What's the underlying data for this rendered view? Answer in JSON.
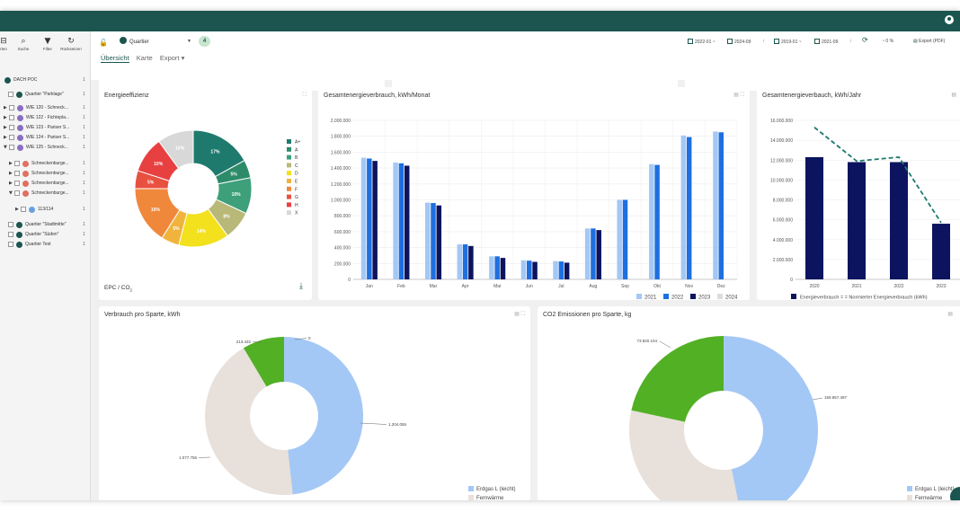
{
  "sidebar": {
    "toolbar": [
      {
        "label": "rten",
        "icon": "filter-funnel-partial-icon"
      },
      {
        "label": "Suche",
        "icon": "search-icon"
      },
      {
        "label": "Filter",
        "icon": "filter-icon"
      },
      {
        "label": "Rücksetzen",
        "icon": "reset-icon"
      }
    ],
    "tree": [
      {
        "label": "DACH POC",
        "count": "1",
        "level": 0,
        "color": "#1c5550"
      },
      {
        "label": "Quartier \"Parklage\"",
        "count": "1",
        "level": 1,
        "color": "#1c5550"
      },
      {
        "label": "WIE 120 - Schneck...",
        "count": "1",
        "level": 2,
        "color": "#8a6fc0"
      },
      {
        "label": "WIE 122 - Fichtepla...",
        "count": "1",
        "level": 2,
        "color": "#8a6fc0"
      },
      {
        "label": "WIE 123 - Pariser S...",
        "count": "1",
        "level": 2,
        "color": "#8a6fc0"
      },
      {
        "label": "WIE 124 - Pariser S...",
        "count": "1",
        "level": 2,
        "color": "#8a6fc0"
      },
      {
        "label": "WIE 125 - Schneck...",
        "count": "1",
        "level": 2,
        "color": "#8a6fc0"
      },
      {
        "label": "Schneckenburge...",
        "count": "1",
        "level": 3,
        "color": "#e07060"
      },
      {
        "label": "Schneckenburge...",
        "count": "1",
        "level": 3,
        "color": "#e07060"
      },
      {
        "label": "Schneckenburge...",
        "count": "1",
        "level": 3,
        "color": "#e07060"
      },
      {
        "label": "Schneckenburge...",
        "count": "1",
        "level": 3,
        "color": "#e07060"
      },
      {
        "label": "113/114",
        "count": "1",
        "level": 4,
        "color": "#6aa0e0"
      },
      {
        "label": "Quartier \"Stadtmitte\"",
        "count": "1",
        "level": 1,
        "color": "#1c5550"
      },
      {
        "label": "Quartier \"Süden\"",
        "count": "1",
        "level": 1,
        "color": "#1c5550"
      },
      {
        "label": "Quartier Test",
        "count": "1",
        "level": 1,
        "color": "#1c5550"
      }
    ]
  },
  "header": {
    "quartier_label": "Quartier",
    "quartier_count": "4",
    "tabs": [
      "Übersicht",
      "Karte",
      "Export ▾"
    ],
    "filters": [
      "2022-01 ~",
      "2024-09",
      "2019-01 ~",
      "2021-09"
    ],
    "percent": "0 %",
    "export_label": "Export (PDF)"
  },
  "cards": {
    "energieeffizienz": {
      "title": "Energieeffizienz",
      "footer": "EPC / CO",
      "footer_sub": "2"
    },
    "monthly": {
      "title": "Gesamtenergieverbrauch, kWh/Monat"
    },
    "yearly": {
      "title": "Gesamtenergieverbauch, kWh/Jahr"
    },
    "sparte": {
      "title": "Verbrauch pro Sparte, kWh"
    },
    "co2": {
      "title": "CO2 Emissionen pro Sparte, kg"
    }
  },
  "chart_data": [
    {
      "type": "pie",
      "variant": "donut",
      "labels": [
        "A+",
        "A",
        "B",
        "C",
        "D",
        "E",
        "F",
        "G",
        "H",
        "X"
      ],
      "values": [
        17,
        5,
        10,
        8,
        14,
        5,
        16,
        5,
        10,
        10
      ],
      "slice_labels": [
        "17%",
        "5%",
        "10%",
        "8%",
        "14%",
        "5%",
        "16%",
        "5%",
        "10%",
        "10%"
      ],
      "colors": [
        "#1f7a6e",
        "#2e8b6a",
        "#3da07a",
        "#b8b878",
        "#f2e11c",
        "#f0b43c",
        "#f0883c",
        "#e85040",
        "#e84040",
        "#d8d8d8"
      ],
      "legend_position": "right"
    },
    {
      "type": "bar",
      "categories": [
        "Jan",
        "Feb",
        "Mar",
        "Apr",
        "Mai",
        "Jun",
        "Jul",
        "Aug",
        "Sep",
        "Okt",
        "Nov",
        "Dez"
      ],
      "series": [
        {
          "name": "2021",
          "color": "#a4c8f5",
          "values": [
            1530000,
            1470000,
            965000,
            440000,
            290000,
            240000,
            230000,
            640000,
            1000000,
            1450000,
            1810000,
            1860000
          ]
        },
        {
          "name": "2022",
          "color": "#1e6fe0",
          "values": [
            1520000,
            1460000,
            960000,
            440000,
            290000,
            235000,
            225000,
            640000,
            1000000,
            1440000,
            1790000,
            1850000
          ]
        },
        {
          "name": "2023",
          "color": "#0c1460",
          "values": [
            1490000,
            1430000,
            930000,
            420000,
            270000,
            220000,
            210000,
            620000,
            null,
            null,
            null,
            null
          ]
        },
        {
          "name": "2024",
          "color": "#dcdcdc",
          "values": [
            null,
            null,
            null,
            null,
            null,
            null,
            null,
            null,
            null,
            null,
            null,
            null
          ]
        }
      ],
      "ylim": [
        0,
        2000000
      ],
      "yticks": [
        "0",
        "200.000",
        "400.000",
        "600.000",
        "800.000",
        "1.000.000",
        "1.200.000",
        "1.400.000",
        "1.600.000",
        "1.800.000",
        "2.000.000"
      ],
      "legend_position": "bottom-right",
      "grid": true
    },
    {
      "type": "bar",
      "categories": [
        "2020",
        "2021",
        "2022",
        "2023"
      ],
      "series": [
        {
          "name": "Energieverbrauch",
          "color": "#0c1460",
          "values": [
            12300000,
            11800000,
            11800000,
            5600000
          ]
        },
        {
          "name": "Normierter Energieverbrauch (kWh)",
          "color": "#1f7a6e",
          "type": "line",
          "values": [
            15300000,
            11900000,
            12300000,
            5700000
          ]
        }
      ],
      "ylim": [
        0,
        16000000
      ],
      "yticks": [
        "0",
        "2.000.000",
        "4.000.000",
        "6.000.000",
        "8.000.000",
        "10.000.000",
        "12.000.000",
        "14.000.000",
        "16.000.000"
      ],
      "legend_position": "bottom",
      "legend_text": "Energieverbrauch = = Normierter Energieverbrauch (kWh)",
      "grid": true
    },
    {
      "type": "pie",
      "variant": "donut",
      "labels": [
        "Erdgas L (leicht)",
        "Fernwärme",
        "Strom"
      ],
      "values": [
        1204055,
        1077755,
        213432
      ],
      "data_labels": [
        "1.204.055",
        "1.077.755",
        "213.432",
        "0"
      ],
      "colors": [
        "#a4c8f5",
        "#e8e0da",
        "#52b025"
      ],
      "legend_position": "bottom-right"
    },
    {
      "type": "pie",
      "variant": "donut",
      "labels": [
        "Erdgas L (leicht)",
        "Fernwärme"
      ],
      "values": [
        159957497,
        108000000,
        73820104
      ],
      "data_labels": [
        "159.957.497",
        "73.820.104"
      ],
      "colors": [
        "#a4c8f5",
        "#e8e0da",
        "#52b025"
      ],
      "legend_position": "bottom-right"
    }
  ]
}
